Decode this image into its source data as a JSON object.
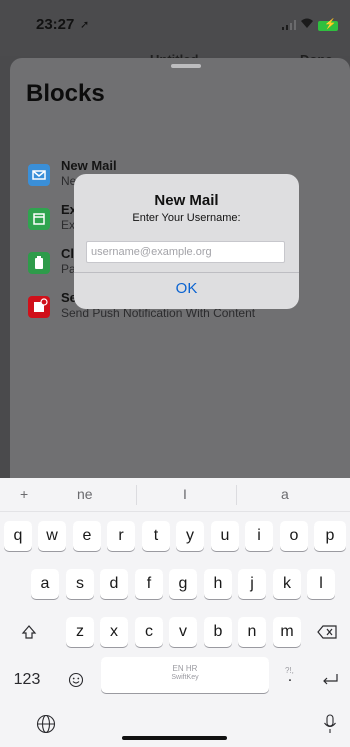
{
  "status": {
    "time": "23:27",
    "location_arrow": "location-arrow-icon"
  },
  "nav": {
    "title": "Untitled",
    "done": "Done"
  },
  "sheet": {
    "title": "Blocks",
    "items": [
      {
        "name": "New Mail",
        "desc": "Ne",
        "color": "#3a8fd8",
        "icon": "mail-icon"
      },
      {
        "name": "Ex",
        "desc": "Ex",
        "color": "#2fa44f",
        "icon": "calendar-icon"
      },
      {
        "name": "Cl",
        "desc": "Pa",
        "color": "#2e9b4a",
        "icon": "clipboard-icon"
      },
      {
        "name": "Se",
        "desc": "Send Push Notification With Content",
        "color": "#d0101a",
        "icon": "notification-icon"
      }
    ]
  },
  "alert": {
    "title": "New Mail",
    "message": "Enter Your Username:",
    "placeholder": "username@example.org",
    "value": "",
    "ok": "OK"
  },
  "keyboard": {
    "predictions": [
      "+",
      "ne",
      "I",
      "a"
    ],
    "rows": [
      [
        "q",
        "w",
        "e",
        "r",
        "t",
        "y",
        "u",
        "i",
        "o",
        "p"
      ],
      [
        "a",
        "s",
        "d",
        "f",
        "g",
        "h",
        "j",
        "k",
        "l"
      ],
      [
        "z",
        "x",
        "c",
        "v",
        "b",
        "n",
        "m"
      ]
    ],
    "numbers_key": "123",
    "space_lang": "EN HR",
    "space_brand": "SwiftKey",
    "punct_hint": "?!,",
    "punct_key": "."
  },
  "colors": {
    "accent": "#0a63d1",
    "battery": "#2fbf3f"
  }
}
